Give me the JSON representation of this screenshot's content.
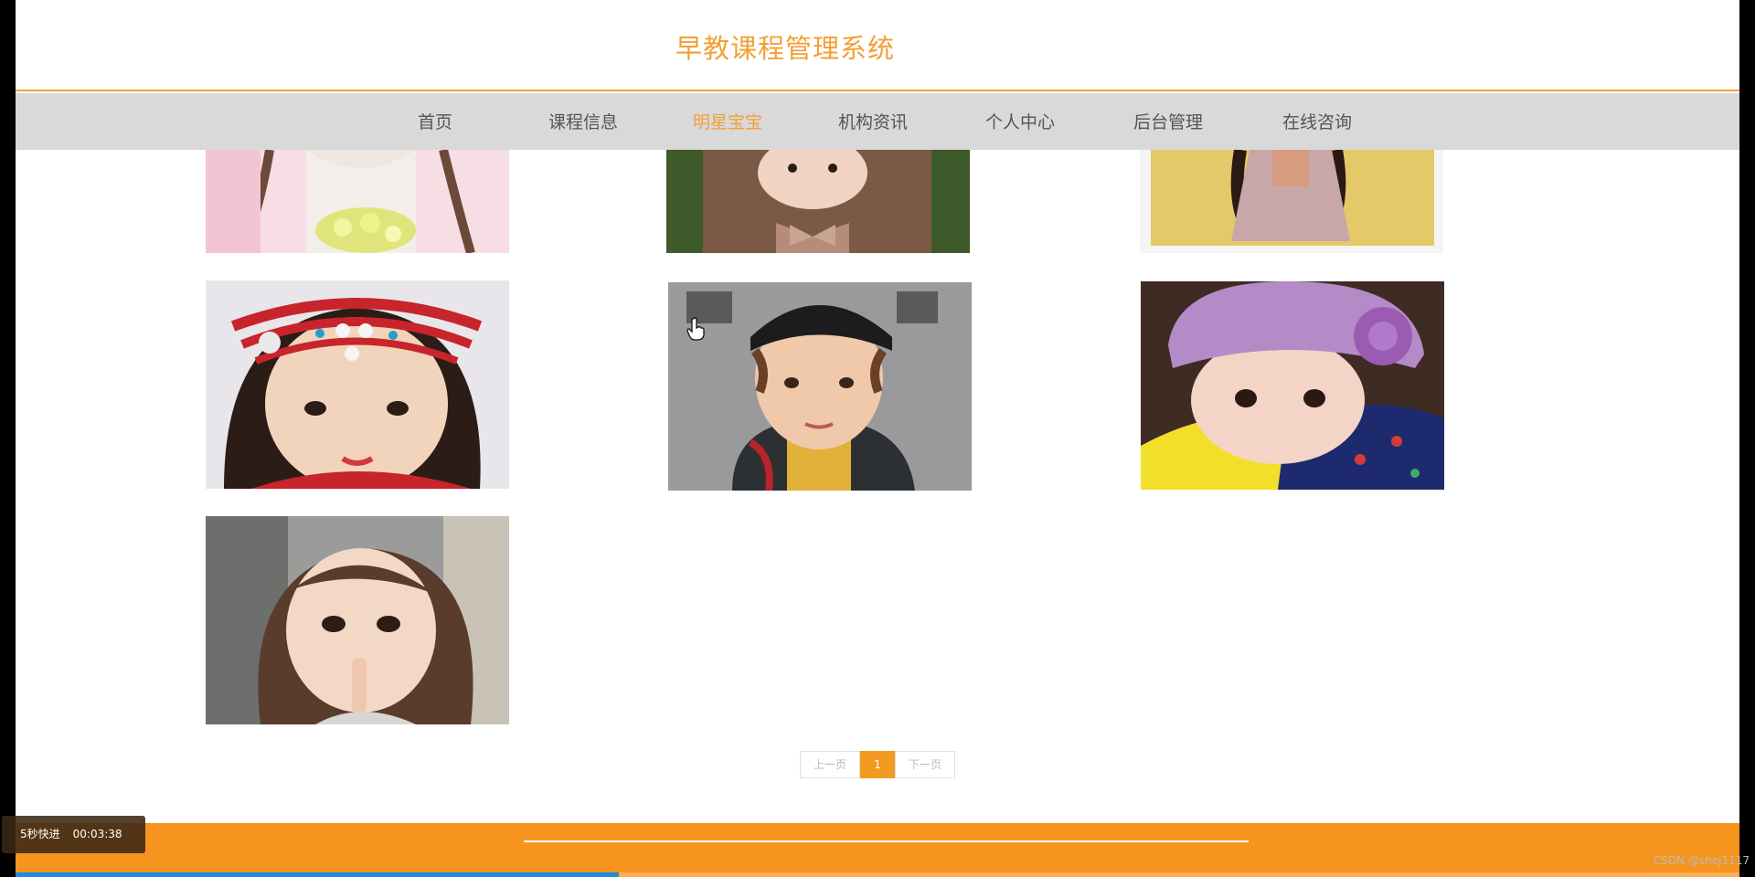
{
  "header": {
    "title": "早教课程管理系统"
  },
  "nav": {
    "items": [
      {
        "label": "首页"
      },
      {
        "label": "课程信息"
      },
      {
        "label": "明星宝宝"
      },
      {
        "label": "机构资讯"
      },
      {
        "label": "个人中心"
      },
      {
        "label": "后台管理"
      },
      {
        "label": "在线咨询"
      }
    ],
    "active": "明星宝宝"
  },
  "pagination": {
    "prev_label": "上一页",
    "current_page": "1",
    "next_label": "下一页"
  },
  "player": {
    "skip_label": "5秒快进",
    "timestamp": "00:03:38",
    "progress_fraction": 0.35
  },
  "watermark": "CSDN @shej1117",
  "colors": {
    "accent": "#f2a035",
    "nav_bg": "#d9d9d9",
    "footer_bg": "#f7941d"
  }
}
